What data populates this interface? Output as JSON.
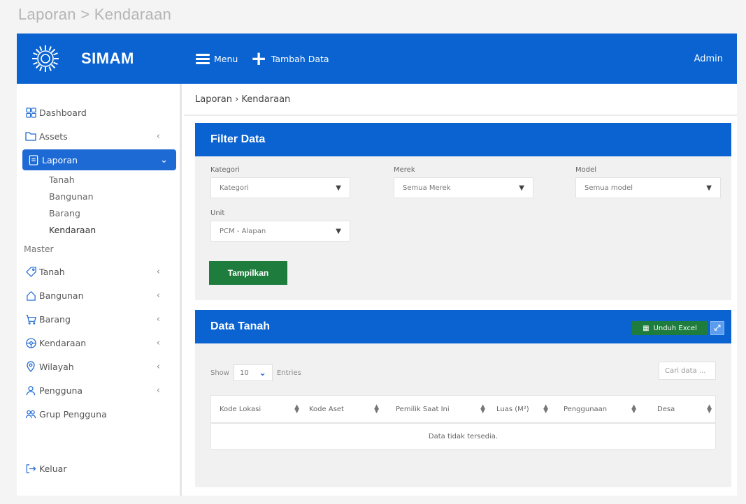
{
  "page_caption": "Laporan > Kendaraan",
  "brand": {
    "name": "SIMAM",
    "logo_icon": "emblem-icon"
  },
  "topbar": {
    "menu_label": "Menu",
    "add_label": "Tambah Data",
    "user": "Admin"
  },
  "sidebar": {
    "items": [
      {
        "label": "Dashboard",
        "icon": "dashboard-icon"
      },
      {
        "label": "Assets",
        "icon": "folder-icon",
        "chevron": "‹"
      },
      {
        "label": "Laporan",
        "icon": "report-icon",
        "chevron": "⌄"
      }
    ],
    "laporan_sub": [
      "Tanah",
      "Bangunan",
      "Barang",
      "Kendaraan"
    ],
    "section_master": "Master",
    "master_items": [
      {
        "label": "Tanah",
        "icon": "tag-icon",
        "chevron": "‹"
      },
      {
        "label": "Bangunan",
        "icon": "home-icon",
        "chevron": "‹"
      },
      {
        "label": "Barang",
        "icon": "cart-icon",
        "chevron": "‹"
      },
      {
        "label": "Kendaraan",
        "icon": "steering-wheel-icon",
        "chevron": "‹"
      },
      {
        "label": "Wilayah",
        "icon": "location-pin-icon",
        "chevron": "‹"
      },
      {
        "label": "Pengguna",
        "icon": "user-icon",
        "chevron": "‹"
      },
      {
        "label": "Grup Pengguna",
        "icon": "users-icon"
      }
    ],
    "logout": "Keluar"
  },
  "breadcrumb": "Laporan › Kendaraan",
  "filter": {
    "title": "Filter Data",
    "kategori_label": "Kategori",
    "kategori_value": "Kategori",
    "merek_label": "Merek",
    "merek_value": "Semua Merek",
    "model_label": "Model",
    "model_value": "Semua model",
    "unit_label": "Unit",
    "unit_value": "PCM - Alapan",
    "submit": "Tampilkan"
  },
  "data_table": {
    "title": "Data Tanah",
    "excel_label": "Unduh Excel",
    "show_label": "Show",
    "page_length": "10",
    "entries_label": "Entries",
    "search_placeholder": "Cari data ...",
    "columns": [
      "Kode Lokasi",
      "Kode Aset",
      "Pemilik Saat Ini",
      "Luas (M²)",
      "Penggunaan",
      "Desa"
    ],
    "empty_message": "Data tidak tersedia."
  }
}
